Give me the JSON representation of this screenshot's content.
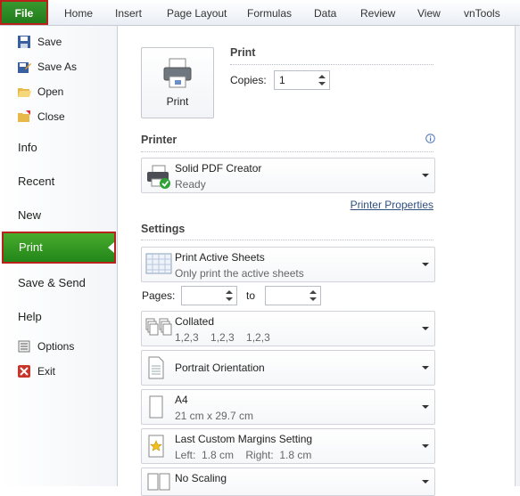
{
  "ribbon": {
    "tabs": [
      "File",
      "Home",
      "Insert",
      "Page Layout",
      "Formulas",
      "Data",
      "Review",
      "View",
      "vnTools"
    ]
  },
  "nav": {
    "small_items": [
      "Save",
      "Save As",
      "Open",
      "Close"
    ],
    "info": "Info",
    "recent": "Recent",
    "new": "New",
    "print": "Print",
    "save_send": "Save & Send",
    "help": "Help",
    "options": "Options",
    "exit": "Exit"
  },
  "print_section": {
    "title": "Print",
    "button_label": "Print",
    "copies_label": "Copies:",
    "copies_value": "1"
  },
  "printer_section": {
    "title": "Printer",
    "printer_name": "Solid PDF Creator",
    "printer_status": "Ready",
    "properties_link": "Printer Properties"
  },
  "settings_section": {
    "title": "Settings",
    "what": {
      "title": "Print Active Sheets",
      "subtitle": "Only print the active sheets"
    },
    "pages_label": "Pages:",
    "to_label": "to",
    "collation": {
      "title": "Collated",
      "subtitle": "1,2,3    1,2,3    1,2,3"
    },
    "orientation": {
      "title": "Portrait Orientation"
    },
    "paper": {
      "title": "A4",
      "subtitle": "21 cm x 29.7 cm"
    },
    "margins": {
      "title": "Last Custom Margins Setting",
      "subtitle": "Left:  1.8 cm    Right:  1.8 cm"
    },
    "scaling": {
      "title": "No Scaling"
    }
  },
  "colors": {
    "accent_green": "#2a8c22",
    "highlight_red": "#b8221a",
    "link_blue": "#2f4f7f"
  }
}
